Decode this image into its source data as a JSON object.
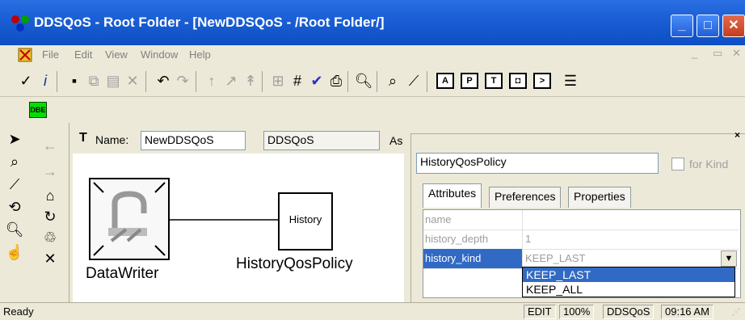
{
  "window": {
    "title": "DDSQoS - Root Folder - [NewDDSQoS - /Root Folder/]"
  },
  "menu": [
    "File",
    "Edit",
    "View",
    "Window",
    "Help"
  ],
  "toolbar2": {
    "dbe_label": "DBE"
  },
  "editor": {
    "name_label": "Name:",
    "name_value": "NewDDSQoS",
    "kind_value": "DDSQoS",
    "aspect_label": "As"
  },
  "canvas": {
    "writer_label": "DataWriter",
    "policy_box_label": "History",
    "policy_label": "HistoryQosPolicy"
  },
  "inspector": {
    "object_name": "HistoryQosPolicy",
    "for_kind_label": "for Kind",
    "tabs": [
      "Attributes",
      "Preferences",
      "Properties"
    ],
    "rows": [
      {
        "key": "name",
        "value": ""
      },
      {
        "key": "history_depth",
        "value": "1"
      },
      {
        "key": "history_kind",
        "value": "KEEP_LAST"
      }
    ]
  },
  "dropdown": {
    "options": [
      "KEEP_LAST",
      "KEEP_ALL"
    ],
    "selected": "KEEP_LAST"
  },
  "status": {
    "text": "Ready",
    "mode": "EDIT",
    "zoom": "100%",
    "paradigm": "DDSQoS",
    "time": "09:16 AM"
  },
  "colors": {
    "titlebar": "#1b5fd6",
    "selection": "#316ac5",
    "dbe": "#00e000"
  }
}
